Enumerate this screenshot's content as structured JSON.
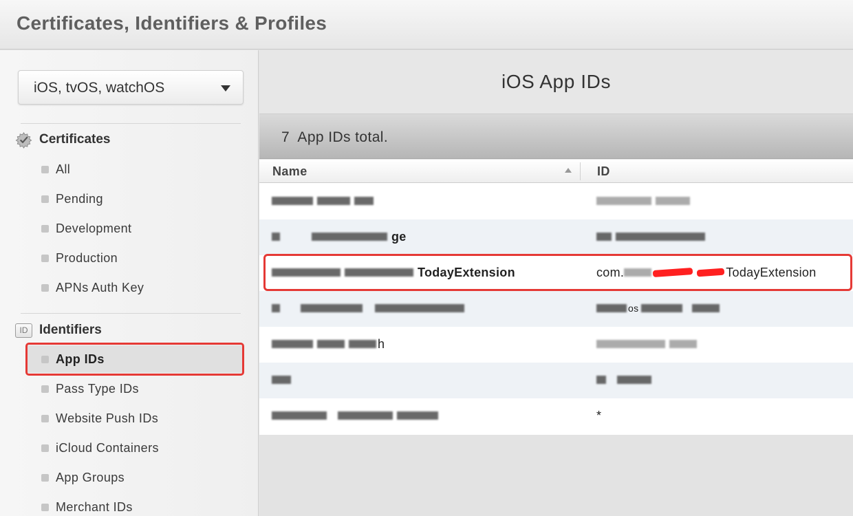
{
  "header": {
    "title": "Certificates, Identifiers & Profiles"
  },
  "sidebar": {
    "platform": "iOS, tvOS, watchOS",
    "sections": [
      {
        "title": "Certificates",
        "icon": "gear-check-icon",
        "items": [
          "All",
          "Pending",
          "Development",
          "Production",
          "APNs Auth Key"
        ]
      },
      {
        "title": "Identifiers",
        "icon": "id-badge-icon",
        "icon_text": "ID",
        "items": [
          "App IDs",
          "Pass Type IDs",
          "Website Push IDs",
          "iCloud Containers",
          "App Groups",
          "Merchant IDs"
        ]
      }
    ],
    "active_item": "App IDs"
  },
  "main": {
    "title": "iOS App IDs",
    "count": "7",
    "count_suffix": "App IDs total.",
    "columns": {
      "name": "Name",
      "id": "ID"
    },
    "rows": [
      {
        "name": "",
        "id": ""
      },
      {
        "name": "ge",
        "id": ""
      },
      {
        "name": "TodayExtension",
        "id_prefix": "com.",
        "id": "TodayExtension"
      },
      {
        "name": "",
        "id": "os"
      },
      {
        "name": "h",
        "id": ""
      },
      {
        "name": "",
        "id": ""
      },
      {
        "name": "",
        "id": "*"
      }
    ]
  },
  "colors": {
    "highlight": "#e53935",
    "redaction": "#ff2020"
  }
}
